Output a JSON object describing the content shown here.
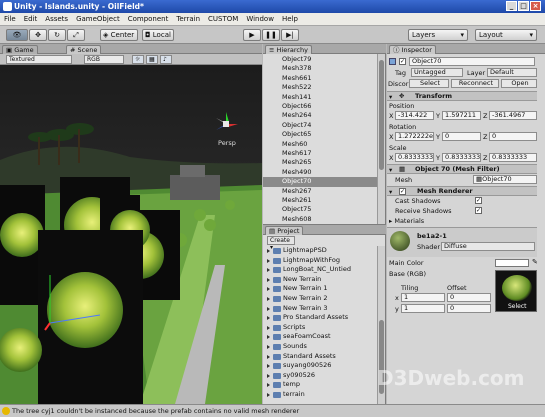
{
  "window": {
    "title": "Unity - Islands.unity - OilField*"
  },
  "menu": [
    "File",
    "Edit",
    "Assets",
    "GameObject",
    "Component",
    "Terrain",
    "CUSTOM",
    "Window",
    "Help"
  ],
  "toolbar": {
    "pivot_label": "Center",
    "space_label": "Local",
    "layers_label": "Layers",
    "layout_label": "Layout"
  },
  "scene": {
    "tab_game": "Game",
    "tab_scene": "Scene",
    "render_mode": "Textured",
    "color_mode": "RGB",
    "gizmo_label": "Persp"
  },
  "hierarchy": {
    "tab": "Hierarchy",
    "items": [
      "Object79",
      "Mesh378",
      "Mesh661",
      "Mesh522",
      "Mesh141",
      "Object66",
      "Mesh264",
      "Object74",
      "Object65",
      "Mesh60",
      "Mesh617",
      "Mesh265",
      "Mesh490",
      "Object70",
      "Mesh267",
      "Mesh261",
      "Object75",
      "Mesh608"
    ],
    "selected_index": 13
  },
  "project": {
    "tab": "Project",
    "create_label": "Create",
    "items": [
      "LightmapPSD",
      "LightmapWithFog",
      "LongBoat_NC_Untied",
      "New Terrain",
      "New Terrain 1",
      "New Terrain 2",
      "New Terrain 3",
      "Pro Standard Assets",
      "Scripts",
      "seaFoamCoast",
      "Sounds",
      "Standard Assets",
      "suyang090526",
      "sy090526",
      "temp",
      "terrain"
    ]
  },
  "inspector": {
    "tab": "Inspector",
    "object_name": "Object70",
    "tag_label": "Tag",
    "tag_value": "Untagged",
    "layer_label": "Layer",
    "layer_value": "Default",
    "prefab_label": "Discor",
    "select_btn": "Select",
    "reconnect_btn": "Reconnect",
    "open_btn": "Open",
    "transform_title": "Transform",
    "position_label": "Position",
    "pos_x": "-314.422",
    "pos_y": "1.597211",
    "pos_z": "-361.4967",
    "rotation_label": "Rotation",
    "rot_x": "1.272222e-",
    "rot_y": "0",
    "rot_z": "0",
    "scale_label": "Scale",
    "scale_x": "0.8333333",
    "scale_y": "0.8333333",
    "scale_z": "0.8333333",
    "meshfilter_title": "Object 70 (Mesh Filter)",
    "mesh_label": "Mesh",
    "mesh_value": "Object70",
    "meshrenderer_title": "Mesh Renderer",
    "cast_shadows": "Cast Shadows",
    "receive_shadows": "Receive Shadows",
    "materials_label": "Materials",
    "material_name": "be1a2-1",
    "shader_label": "Shader",
    "shader_value": "Diffuse",
    "main_color_label": "Main Color",
    "base_label": "Base (RGB)",
    "tiling_label": "Tiling",
    "offset_label": "Offset",
    "tiling_x": "1",
    "tiling_y": "1",
    "offset_x": "0",
    "offset_y": "0",
    "x_label": "x",
    "y_label": "y",
    "texture_select": "Select"
  },
  "axis_labels": {
    "x": "X",
    "y": "Y",
    "z": "Z"
  },
  "status": {
    "message": "The tree cyj1 couldn't be instanced because the prefab contains no valid mesh renderer"
  },
  "watermark": "D3Dweb.com"
}
